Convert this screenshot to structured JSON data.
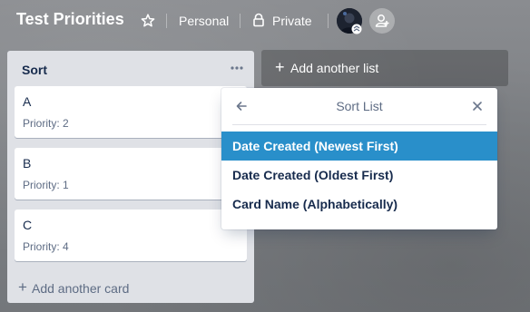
{
  "board": {
    "title": "Test Priorities",
    "team": "Personal",
    "visibility": "Private",
    "icons": {
      "star": "star-icon",
      "lock": "lock-icon",
      "add_member": "add-member-icon"
    }
  },
  "lists": [
    {
      "title": "Sort",
      "cards": [
        {
          "title": "A",
          "priority": "Priority: 2"
        },
        {
          "title": "B",
          "priority": "Priority: 1"
        },
        {
          "title": "C",
          "priority": "Priority: 4"
        }
      ],
      "add_card_label": "Add another card"
    }
  ],
  "add_list_label": "Add another list",
  "sort_popover": {
    "title": "Sort List",
    "options": [
      {
        "label": "Date Created (Newest First)",
        "selected": true
      },
      {
        "label": "Date Created (Oldest First)",
        "selected": false
      },
      {
        "label": "Card Name (Alphabetically)",
        "selected": false
      }
    ]
  },
  "colors": {
    "selected_option": "#298fca",
    "list_background": "#dfe1e6",
    "text_primary": "#172b4d",
    "text_muted": "#5e6c84"
  }
}
